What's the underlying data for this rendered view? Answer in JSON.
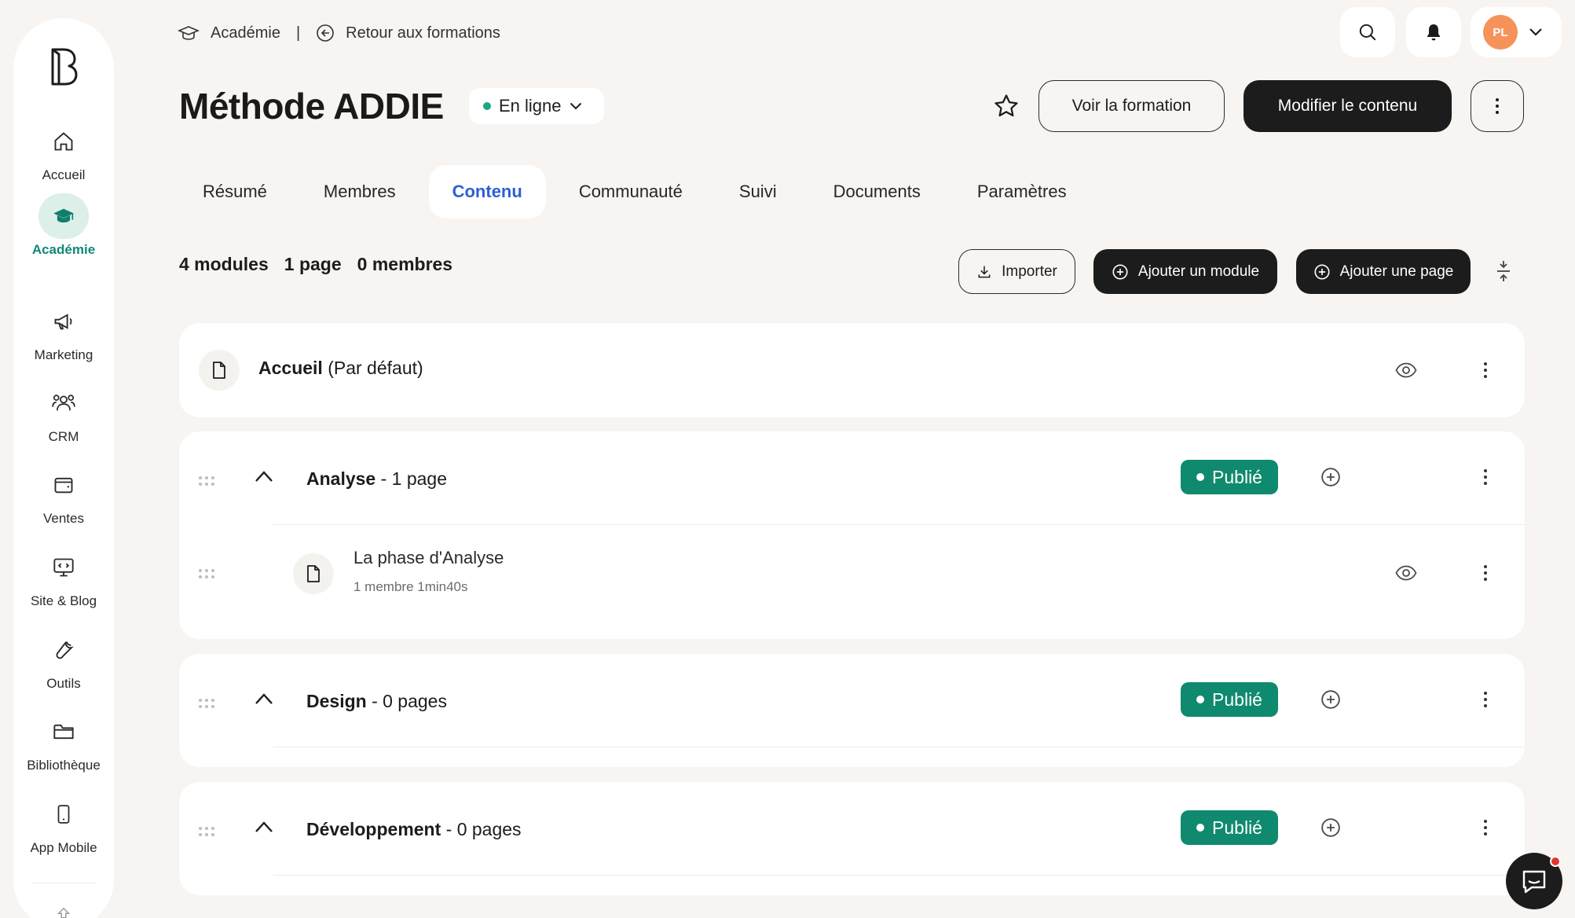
{
  "sidebar": {
    "items": [
      {
        "label": "Accueil",
        "icon": "home-icon"
      },
      {
        "label": "Académie",
        "icon": "graduation-cap-icon",
        "active": true
      },
      {
        "label": "Marketing",
        "icon": "megaphone-icon"
      },
      {
        "label": "CRM",
        "icon": "users-icon"
      },
      {
        "label": "Ventes",
        "icon": "wallet-icon"
      },
      {
        "label": "Site & Blog",
        "icon": "monitor-icon"
      },
      {
        "label": "Outils",
        "icon": "wrench-icon"
      },
      {
        "label": "Bibliothèque",
        "icon": "folder-icon"
      },
      {
        "label": "App Mobile",
        "icon": "smartphone-icon"
      }
    ]
  },
  "breadcrumb": {
    "section": "Académie",
    "separator": "|",
    "back": "Retour aux formations"
  },
  "user": {
    "initials": "PL",
    "avatar_color": "#f5935a"
  },
  "header": {
    "title": "Méthode ADDIE",
    "status": "En ligne",
    "view_button": "Voir la formation",
    "edit_button": "Modifier le contenu"
  },
  "tabs": [
    {
      "label": "Résumé"
    },
    {
      "label": "Membres"
    },
    {
      "label": "Contenu",
      "active": true
    },
    {
      "label": "Communauté"
    },
    {
      "label": "Suivi"
    },
    {
      "label": "Documents"
    },
    {
      "label": "Paramètres"
    }
  ],
  "stats": {
    "modules": "4 modules",
    "pages": "1 page",
    "members": "0 membres"
  },
  "actions": {
    "import": "Importer",
    "add_module": "Ajouter un module",
    "add_page": "Ajouter une page"
  },
  "home_page": {
    "title": "Accueil",
    "suffix": "(Par défaut)"
  },
  "modules": [
    {
      "title": "Analyse",
      "count": "- 1 page",
      "status": "Publié",
      "pages": [
        {
          "title": "La phase d'Analyse",
          "meta": "1 membre 1min40s"
        }
      ]
    },
    {
      "title": "Design",
      "count": "- 0 pages",
      "status": "Publié",
      "pages": []
    },
    {
      "title": "Développement",
      "count": "- 0 pages",
      "status": "Publié",
      "pages": []
    }
  ],
  "colors": {
    "accent_blue": "#2d5fd6",
    "published_green": "#0f8a6e",
    "active_nav_bg": "#dcefe9",
    "background": "#f7f4f1"
  }
}
